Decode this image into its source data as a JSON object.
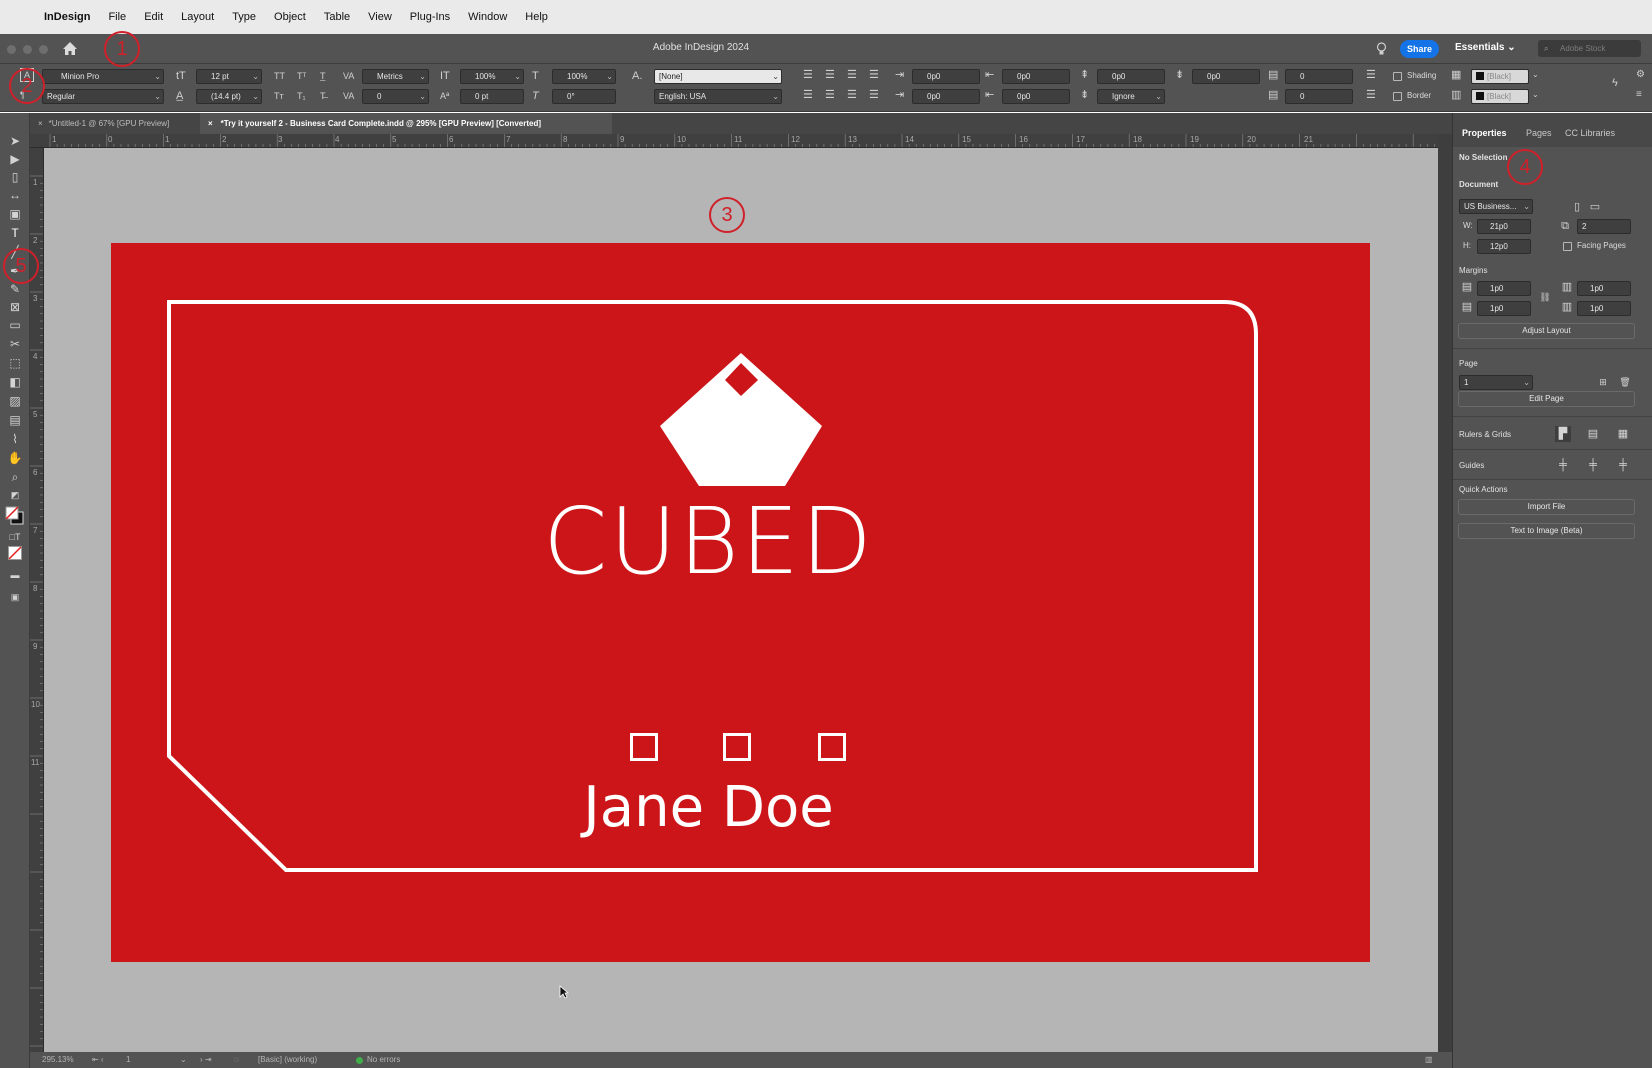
{
  "menubar": {
    "app_name": "InDesign",
    "items": [
      "File",
      "Edit",
      "Layout",
      "Type",
      "Object",
      "Table",
      "View",
      "Plug-Ins",
      "Window",
      "Help"
    ]
  },
  "appbar": {
    "title": "Adobe InDesign 2024",
    "share_label": "Share",
    "workspace": "Essentials",
    "stock_placeholder": "Adobe Stock"
  },
  "control": {
    "font_family": "Minion Pro",
    "font_style": "Regular",
    "font_size": "12 pt",
    "leading": "(14.4 pt)",
    "kerning": "Metrics",
    "tracking": "0",
    "vscale": "100%",
    "hscale": "100%",
    "baseline": "0 pt",
    "skew": "0°",
    "char_style": "[None]",
    "language": "English: USA",
    "indent_values": [
      "0p0",
      "0p0",
      "0p0",
      "0p0",
      "0p0",
      "0p0"
    ],
    "hyphen": "Ignore",
    "space_values": [
      "0p0",
      "0p0",
      "0",
      "0"
    ],
    "shading_label": "Shading",
    "border_label": "Border",
    "swatch_1": "[Black]",
    "swatch_2": "[Black]"
  },
  "tabs": [
    {
      "label": "*Untitled-1 @ 67% [GPU Preview]",
      "active": false
    },
    {
      "label": "*Try it yourself 2 - Business Card Complete.indd @ 295% [GPU Preview] [Converted]",
      "active": true
    }
  ],
  "ruler": {
    "h_labels": [
      "1",
      "0",
      "1",
      "2",
      "3",
      "4",
      "5",
      "6",
      "7",
      "8",
      "9",
      "10",
      "11",
      "12",
      "13",
      "14",
      "15",
      "16",
      "17",
      "18",
      "19",
      "20",
      "21"
    ],
    "v_labels": [
      "1",
      "2",
      "3",
      "4",
      "5",
      "6",
      "7",
      "8",
      "9",
      "10",
      "11"
    ]
  },
  "card": {
    "brand": "CUBED",
    "name": "Jane Doe",
    "bg_color": "#cc1518",
    "fg_color": "#ffffff"
  },
  "statusbar": {
    "zoom": "295.13%",
    "page": "1",
    "profile": "[Basic] (working)",
    "errors": "No errors"
  },
  "panel": {
    "tabs": [
      "Properties",
      "Pages",
      "CC Libraries"
    ],
    "selection": "No Selection",
    "document_label": "Document",
    "preset": "US Business...",
    "width_label": "W:",
    "width": "21p0",
    "height_label": "H:",
    "height": "12p0",
    "pages_count": "2",
    "facing_pages": "Facing Pages",
    "margins_label": "Margins",
    "margins": [
      "1p0",
      "1p0",
      "1p0",
      "1p0"
    ],
    "adjust_layout": "Adjust Layout",
    "page_label": "Page",
    "page_value": "1",
    "edit_page": "Edit Page",
    "rulers_grids": "Rulers & Grids",
    "guides": "Guides",
    "quick_actions": "Quick Actions",
    "import_file": "Import File",
    "text_to_image": "Text to Image (Beta)"
  },
  "annotations": [
    "1",
    "2",
    "3",
    "4",
    "5"
  ]
}
